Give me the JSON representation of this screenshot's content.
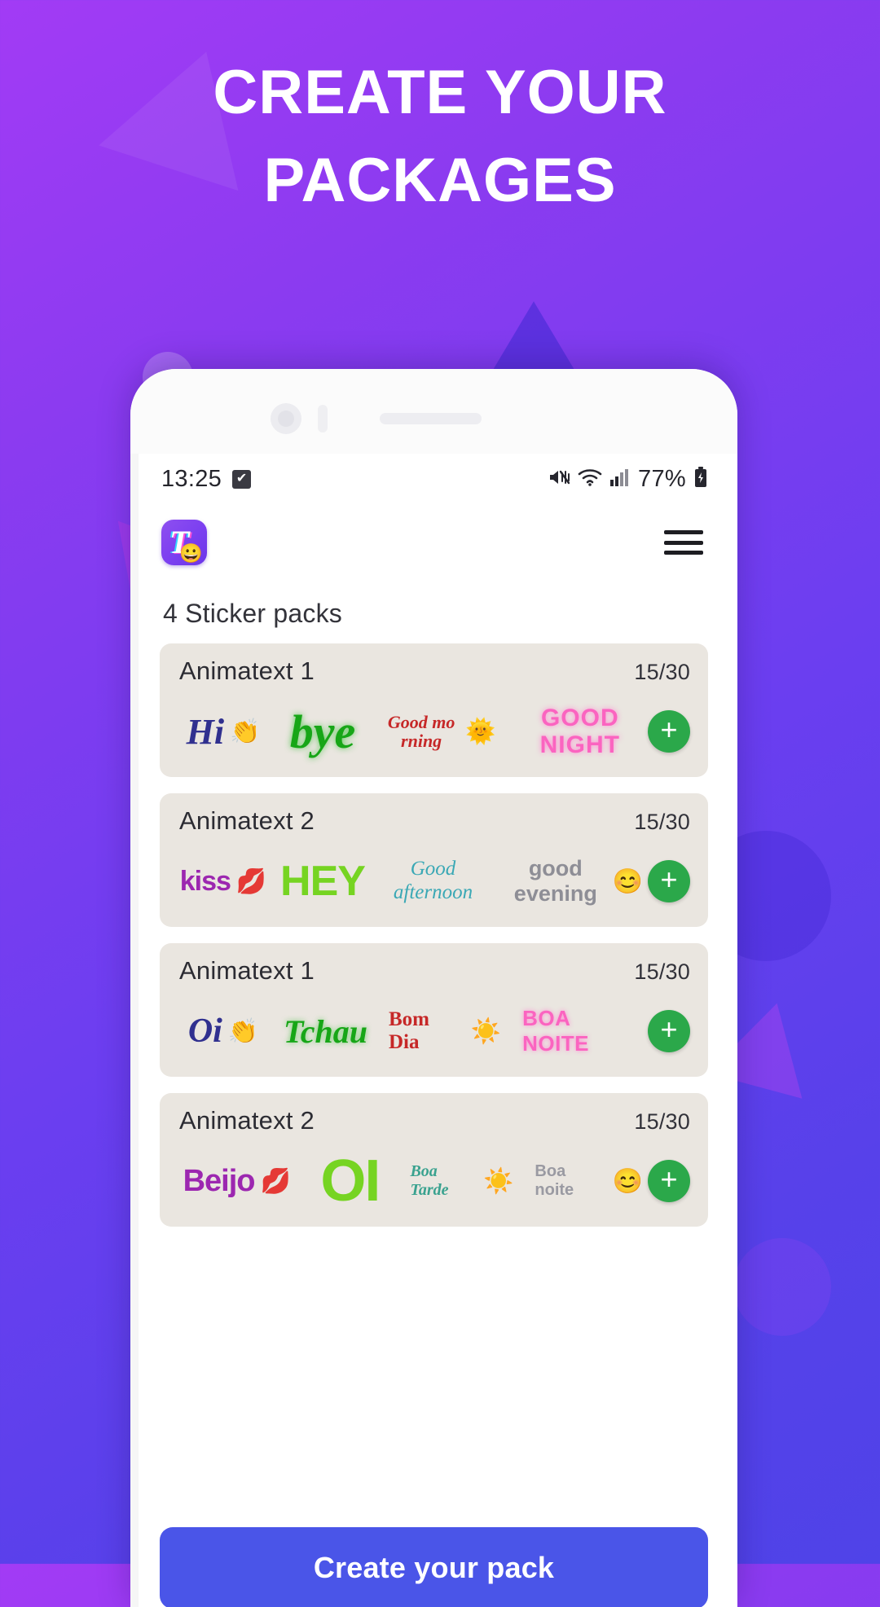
{
  "promo": {
    "headline_line1": "CREATE YOUR",
    "headline_line2": "PACKAGES",
    "background_accent": "#7b3ff0"
  },
  "status_bar": {
    "time": "13:25",
    "check_icon": "✔",
    "mute_icon": "mute-icon",
    "wifi_icon": "wifi-icon",
    "signal_icon": "signal-icon",
    "battery_percent": "77%",
    "battery_icon": "battery-icon"
  },
  "app_bar": {
    "logo_letter": "T",
    "logo_emoji": "😀",
    "menu_icon": "hamburger-menu-icon"
  },
  "main": {
    "section_title": "4 Sticker packs",
    "add_label": "+",
    "packs": [
      {
        "name": "Animatext 1",
        "count": "15/30",
        "stickers": [
          {
            "text": "Hi",
            "emoji": "👏",
            "style": "s-hi"
          },
          {
            "text": "bye",
            "emoji": "",
            "style": "s-bye"
          },
          {
            "text": "Good mo rning",
            "emoji": "🌞",
            "style": "s-gm"
          },
          {
            "text": "GOOD NIGHT",
            "emoji": "",
            "style": "s-gn"
          }
        ]
      },
      {
        "name": "Animatext 2",
        "count": "15/30",
        "stickers": [
          {
            "text": "kiss",
            "emoji": "💋",
            "style": "s-kiss"
          },
          {
            "text": "HEY",
            "emoji": "",
            "style": "s-hey"
          },
          {
            "text": "Good afternoon",
            "emoji": "",
            "style": "s-ga"
          },
          {
            "text": "good evening",
            "emoji": "😊",
            "style": "s-ge"
          }
        ]
      },
      {
        "name": "Animatext 1",
        "count": "15/30",
        "stickers": [
          {
            "text": "Oi",
            "emoji": "👏",
            "style": "s-oi"
          },
          {
            "text": "Tchau",
            "emoji": "",
            "style": "s-tchau"
          },
          {
            "text": "Bom Dia",
            "emoji": "☀️",
            "style": "s-bd"
          },
          {
            "text": "BOA NOITE",
            "emoji": "",
            "style": "s-bn"
          }
        ]
      },
      {
        "name": "Animatext 2",
        "count": "15/30",
        "stickers": [
          {
            "text": "Beijo",
            "emoji": "💋",
            "style": "s-beijo"
          },
          {
            "text": "OI",
            "emoji": "",
            "style": "s-oi2"
          },
          {
            "text": "Boa Tarde",
            "emoji": "☀️",
            "style": "s-bt"
          },
          {
            "text": "Boa noite",
            "emoji": "😊",
            "style": "s-bnoi"
          }
        ]
      }
    ]
  },
  "cta": {
    "label": "Create your pack",
    "color": "#4a55e8"
  }
}
